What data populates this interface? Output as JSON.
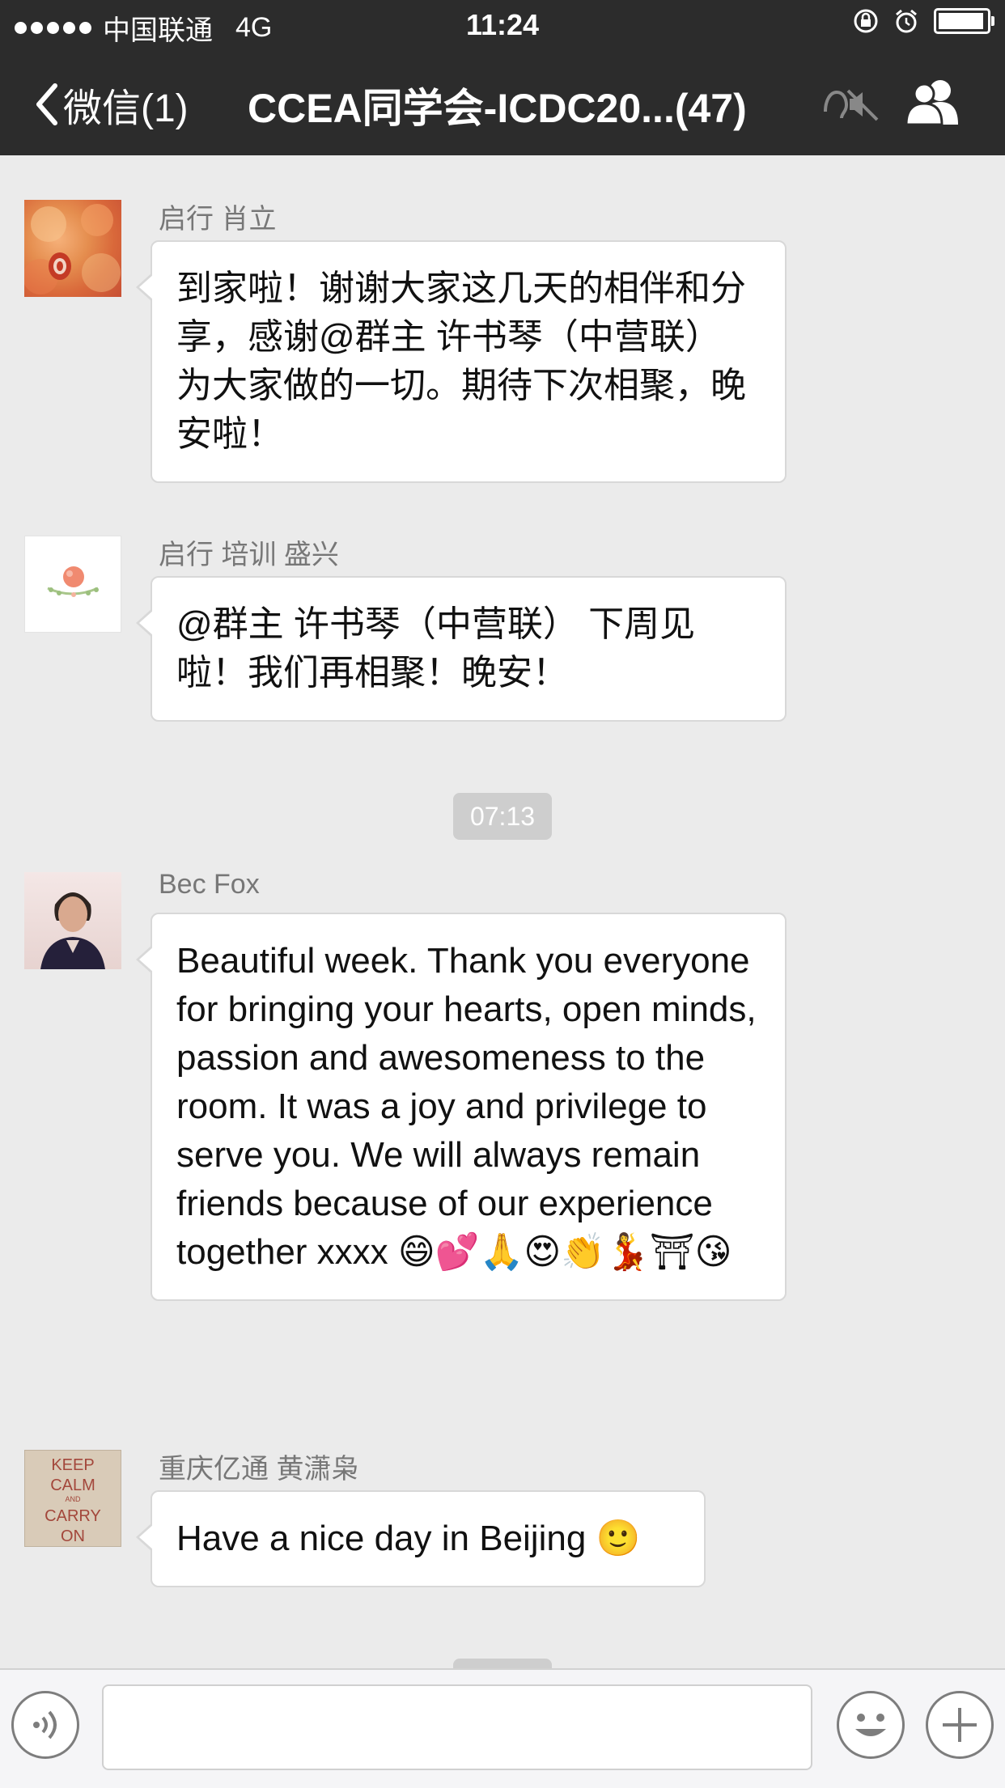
{
  "status_bar": {
    "carrier": "中国联通",
    "network": "4G",
    "time": "11:24",
    "battery_level": 0.95
  },
  "nav": {
    "back_label": "微信(1)",
    "title": "CCEA同学会-ICDC20...(47)"
  },
  "messages": [
    {
      "sender": "启行 肖立",
      "text": "到家啦！谢谢大家这几天的相伴和分享，感谢@群主 许书琴（中营联） 为大家做的一切。期待下次相聚，晚安啦！"
    },
    {
      "sender": "启行 培训 盛兴",
      "text": "@群主 许书琴（中营联） 下周见啦！我们再相聚！晚安！"
    },
    {
      "sender": "Bec Fox",
      "text": "Beautiful week. Thank you everyone for bringing your hearts, open minds, passion and  awesomeness to the room. It was a joy and privilege to serve you. We will always remain friends because of our experience together xxxx 😄💕🙏😍👏💃⛩😘"
    },
    {
      "sender": "重庆亿通 黄潇枭",
      "text": "Have a nice day in Beijing 🙂"
    }
  ],
  "timestamp": "07:13",
  "keep_calm_text": "KEEP CALM AND CARRY ON",
  "colors": {
    "header_bg": "#2c2c2c",
    "chat_bg": "#ebebeb",
    "bubble_bg": "#ffffff",
    "timestamp_bg": "#cecece"
  }
}
